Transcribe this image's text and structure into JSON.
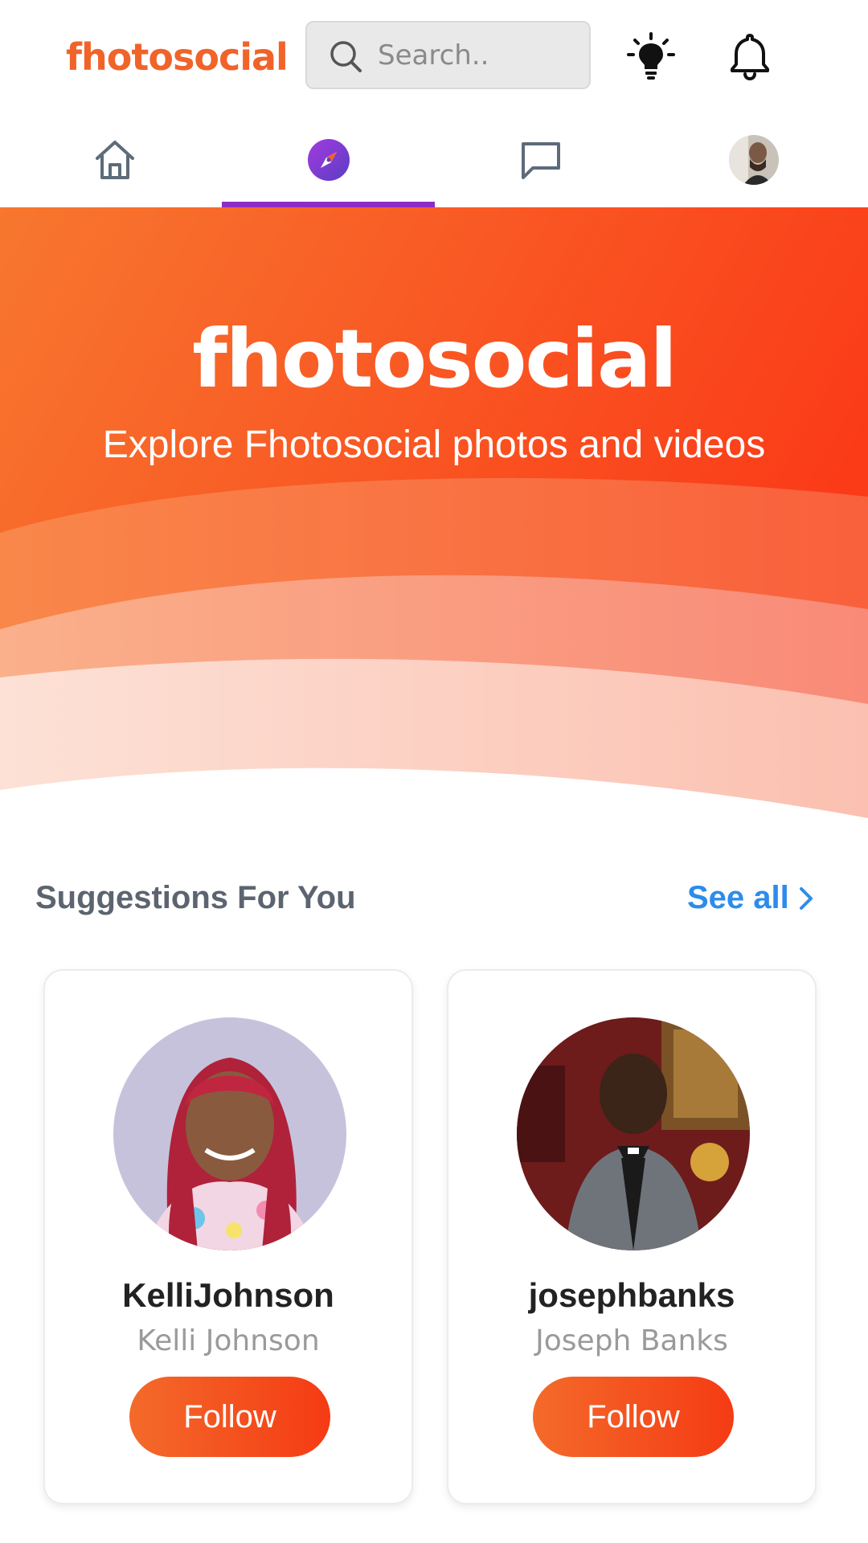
{
  "header": {
    "logo_text": "fhotosocial",
    "search_placeholder": "Search.."
  },
  "nav": {
    "items": [
      {
        "name": "home",
        "icon": "home-icon"
      },
      {
        "name": "explore",
        "icon": "compass-icon",
        "active": true
      },
      {
        "name": "messages",
        "icon": "chat-icon"
      },
      {
        "name": "profile",
        "icon": "avatar"
      }
    ]
  },
  "hero": {
    "title": "fhotosocial",
    "subtitle": "Explore Fhotosocial photos and videos"
  },
  "suggestions": {
    "heading": "Suggestions For You",
    "see_all": "See all",
    "people": [
      {
        "username": "KelliJohnson",
        "full_name": "Kelli Johnson",
        "button": "Follow"
      },
      {
        "username": "josephbanks",
        "full_name": "Joseph Banks",
        "button": "Follow"
      }
    ]
  },
  "colors": {
    "brand": "#f0642a",
    "accent_purple": "#8c2cc7",
    "link_blue": "#2d8ceb"
  }
}
